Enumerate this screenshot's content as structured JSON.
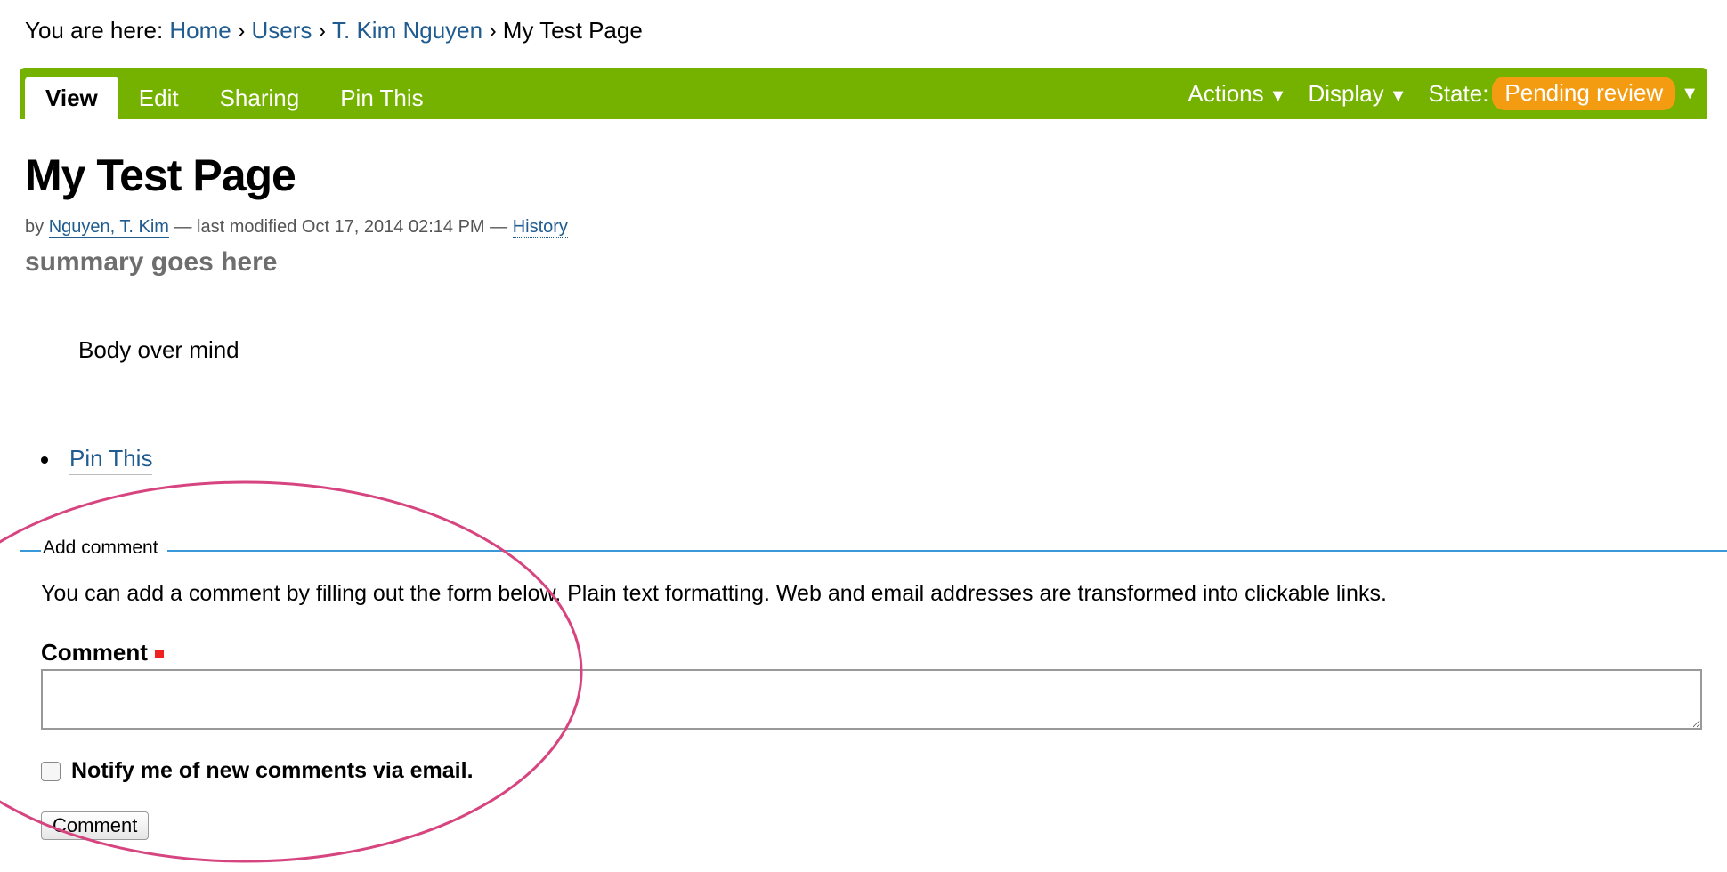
{
  "breadcrumb": {
    "prefix": "You are here:",
    "items": [
      "Home",
      "Users",
      "T. Kim Nguyen"
    ],
    "current": "My Test Page",
    "separator": "›"
  },
  "toolbar": {
    "tabs": [
      {
        "label": "View",
        "active": true
      },
      {
        "label": "Edit",
        "active": false
      },
      {
        "label": "Sharing",
        "active": false
      },
      {
        "label": "Pin This",
        "active": false
      }
    ],
    "actions_label": "Actions",
    "display_label": "Display",
    "state_label": "State:",
    "state_value": "Pending review",
    "caret": "▼",
    "colors": {
      "bar": "#75b200",
      "state": "#f39c12"
    }
  },
  "page": {
    "title": "My Test Page",
    "by": "by",
    "author": "Nguyen, T. Kim",
    "modified": "— last modified Oct 17, 2014 02:14 PM —",
    "history": "History",
    "summary": "summary goes here",
    "body": "Body over mind"
  },
  "links": [
    {
      "label": "Pin This"
    }
  ],
  "comment_form": {
    "legend": "Add comment",
    "help": "You can add a comment by filling out the form below. Plain text formatting. Web and email addresses are transformed into clickable links.",
    "comment_label": "Comment",
    "comment_value": "",
    "notify_label": "Notify me of new comments via email.",
    "notify_checked": false,
    "submit_label": "Comment"
  },
  "annotation": {
    "color": "#d6457f"
  }
}
